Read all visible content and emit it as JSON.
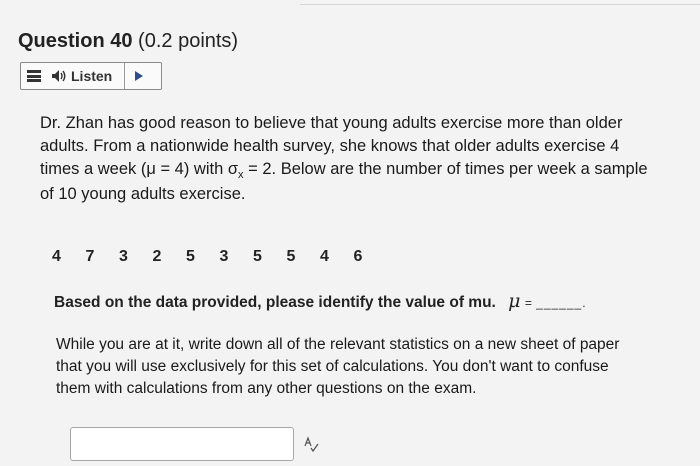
{
  "question": {
    "title": "Question 40",
    "points": "(0.2 points)"
  },
  "listen": {
    "menu_icon": "menu-icon",
    "speaker_icon": "speaker-icon",
    "label": "Listen",
    "play_icon": "play-icon"
  },
  "passage": {
    "line1": "Dr. Zhan has good reason to believe that young adults exercise more than older",
    "line2": "adults. From a nationwide health survey, she knows that older adults exercise 4",
    "line3_a": "times a week (μ = 4) with σ",
    "line3_sub": "x",
    "line3_b": " = 2.  Below are the number of times per week a sample",
    "line4": "of 10 young adults exercise."
  },
  "data_values": [
    "4",
    "7",
    "3",
    "2",
    "5",
    "3",
    "5",
    "5",
    "4",
    "6"
  ],
  "prompt": {
    "text": "Based on the data provided, please identify the value of mu.",
    "mu_symbol": "μ",
    "equals": "=",
    "blank": "______."
  },
  "instruction": {
    "line1": "While you are at it, write down all of the relevant statistics on a new sheet of paper",
    "line2": "that you will use exclusively for this set of calculations. You don't want to confuse",
    "line3": "them with calculations from any other questions on the exam."
  },
  "answer": {
    "value": "",
    "spellcheck_icon": "spellcheck-icon"
  }
}
